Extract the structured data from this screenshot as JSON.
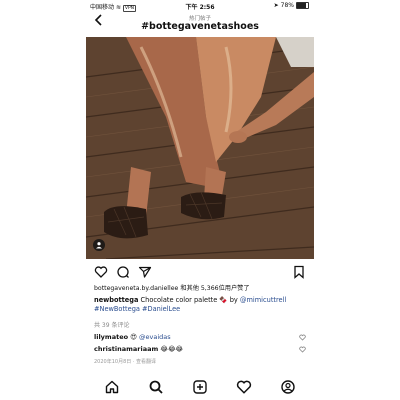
{
  "status": {
    "carrier": "中国移动",
    "network": "VPN",
    "time": "下午 2:56",
    "battery": "78%",
    "battery_level": 0.78
  },
  "header": {
    "subtitle": "热门帖子",
    "title": "#bottegavenetashoes"
  },
  "post": {
    "likes_text": "bottegaveneta.by.daniellee 和其他 5,366位用户赞了",
    "caption": {
      "user": "newbottega",
      "text": " Chocolate color palette 🍫 by ",
      "mention": "@mimicuttrell",
      "hashtags": "#NewBottega #DanielLee"
    },
    "comments_count": "共 39 条评论",
    "comments": [
      {
        "user": "lilymateo",
        "emoji": "😍",
        "text": "@evaidas"
      },
      {
        "user": "christinamariaam",
        "emoji": "",
        "text": "😂😂😂"
      }
    ],
    "meta": "2020年10月8日 · 查看翻译"
  },
  "icons": {
    "back": "chevron-left-icon",
    "like": "heart-icon",
    "comment": "comment-icon",
    "share": "paper-plane-icon",
    "save": "bookmark-icon",
    "tabs": [
      "home-icon",
      "search-icon",
      "add-post-icon",
      "activity-heart-icon",
      "profile-icon"
    ]
  }
}
